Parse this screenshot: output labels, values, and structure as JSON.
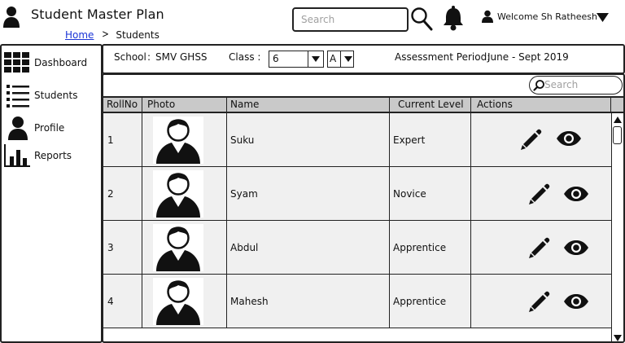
{
  "header": {
    "title": "Student Master Plan",
    "search_placeholder": "Search",
    "welcome_text": "Welcome Sh Ratheesh"
  },
  "breadcrumb": {
    "home": "Home",
    "current": "Students"
  },
  "sidebar": {
    "items": [
      {
        "label": "Dashboard",
        "icon": "grid-icon"
      },
      {
        "label": "Students",
        "icon": "list-icon"
      },
      {
        "label": "Profile",
        "icon": "user-icon"
      },
      {
        "label": "Reports",
        "icon": "bar-chart-icon"
      }
    ]
  },
  "filters": {
    "school_label": "School",
    "school_sep": ":",
    "school_value": "SMV GHSS",
    "class_label": "Class :",
    "class_value": "6",
    "division_value": "A",
    "period_label": "Assessment Period:",
    "period_value": "June - Sept 2019"
  },
  "table": {
    "search_placeholder": "Search",
    "columns": [
      "RollNo",
      "Photo",
      "Name",
      "Current Level",
      "Actions"
    ],
    "rows": [
      {
        "roll": "1",
        "name": "Suku",
        "level": "Expert"
      },
      {
        "roll": "2",
        "name": "Syam",
        "level": "Novice"
      },
      {
        "roll": "3",
        "name": "Abdul",
        "level": "Apprentice"
      },
      {
        "roll": "4",
        "name": "Mahesh",
        "level": "Apprentice"
      }
    ]
  },
  "icons": {
    "edit": "pencil-icon",
    "view": "eye-icon",
    "notifications": "bell-icon",
    "search": "search-icon"
  }
}
